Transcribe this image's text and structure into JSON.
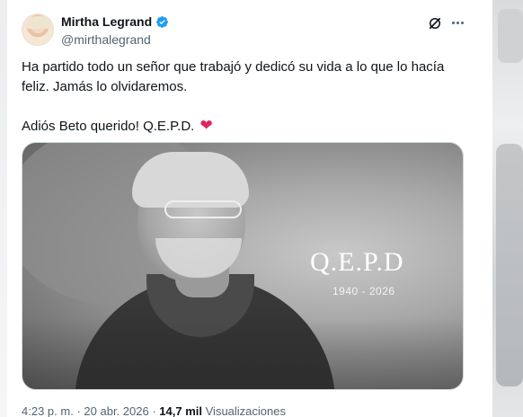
{
  "author": {
    "display_name": "Mirtha Legrand",
    "handle": "@mirthalegrand",
    "verified": true
  },
  "tweet": {
    "line1": "Ha partido todo un señor que trabajó y dedicó su vida a lo que lo hacía feliz. Jamás lo olvidaremos.",
    "line2": "Adiós Beto querido! Q.E.P.D.",
    "emoji": "❤"
  },
  "media": {
    "overlay_title": "Q.E.P.D",
    "overlay_years": "1940 - 2026"
  },
  "meta": {
    "time": "4:23 p. m.",
    "separator": "·",
    "date": "20 abr. 2026",
    "views_count": "14,7 mil",
    "views_label": "Visualizaciones"
  },
  "colors": {
    "verified": "#1d9bf0",
    "heart": "#e0245e",
    "secondary_text": "#536471"
  },
  "icons": {
    "grok": "grok-icon",
    "more": "more-icon",
    "verified": "verified-badge-icon"
  }
}
